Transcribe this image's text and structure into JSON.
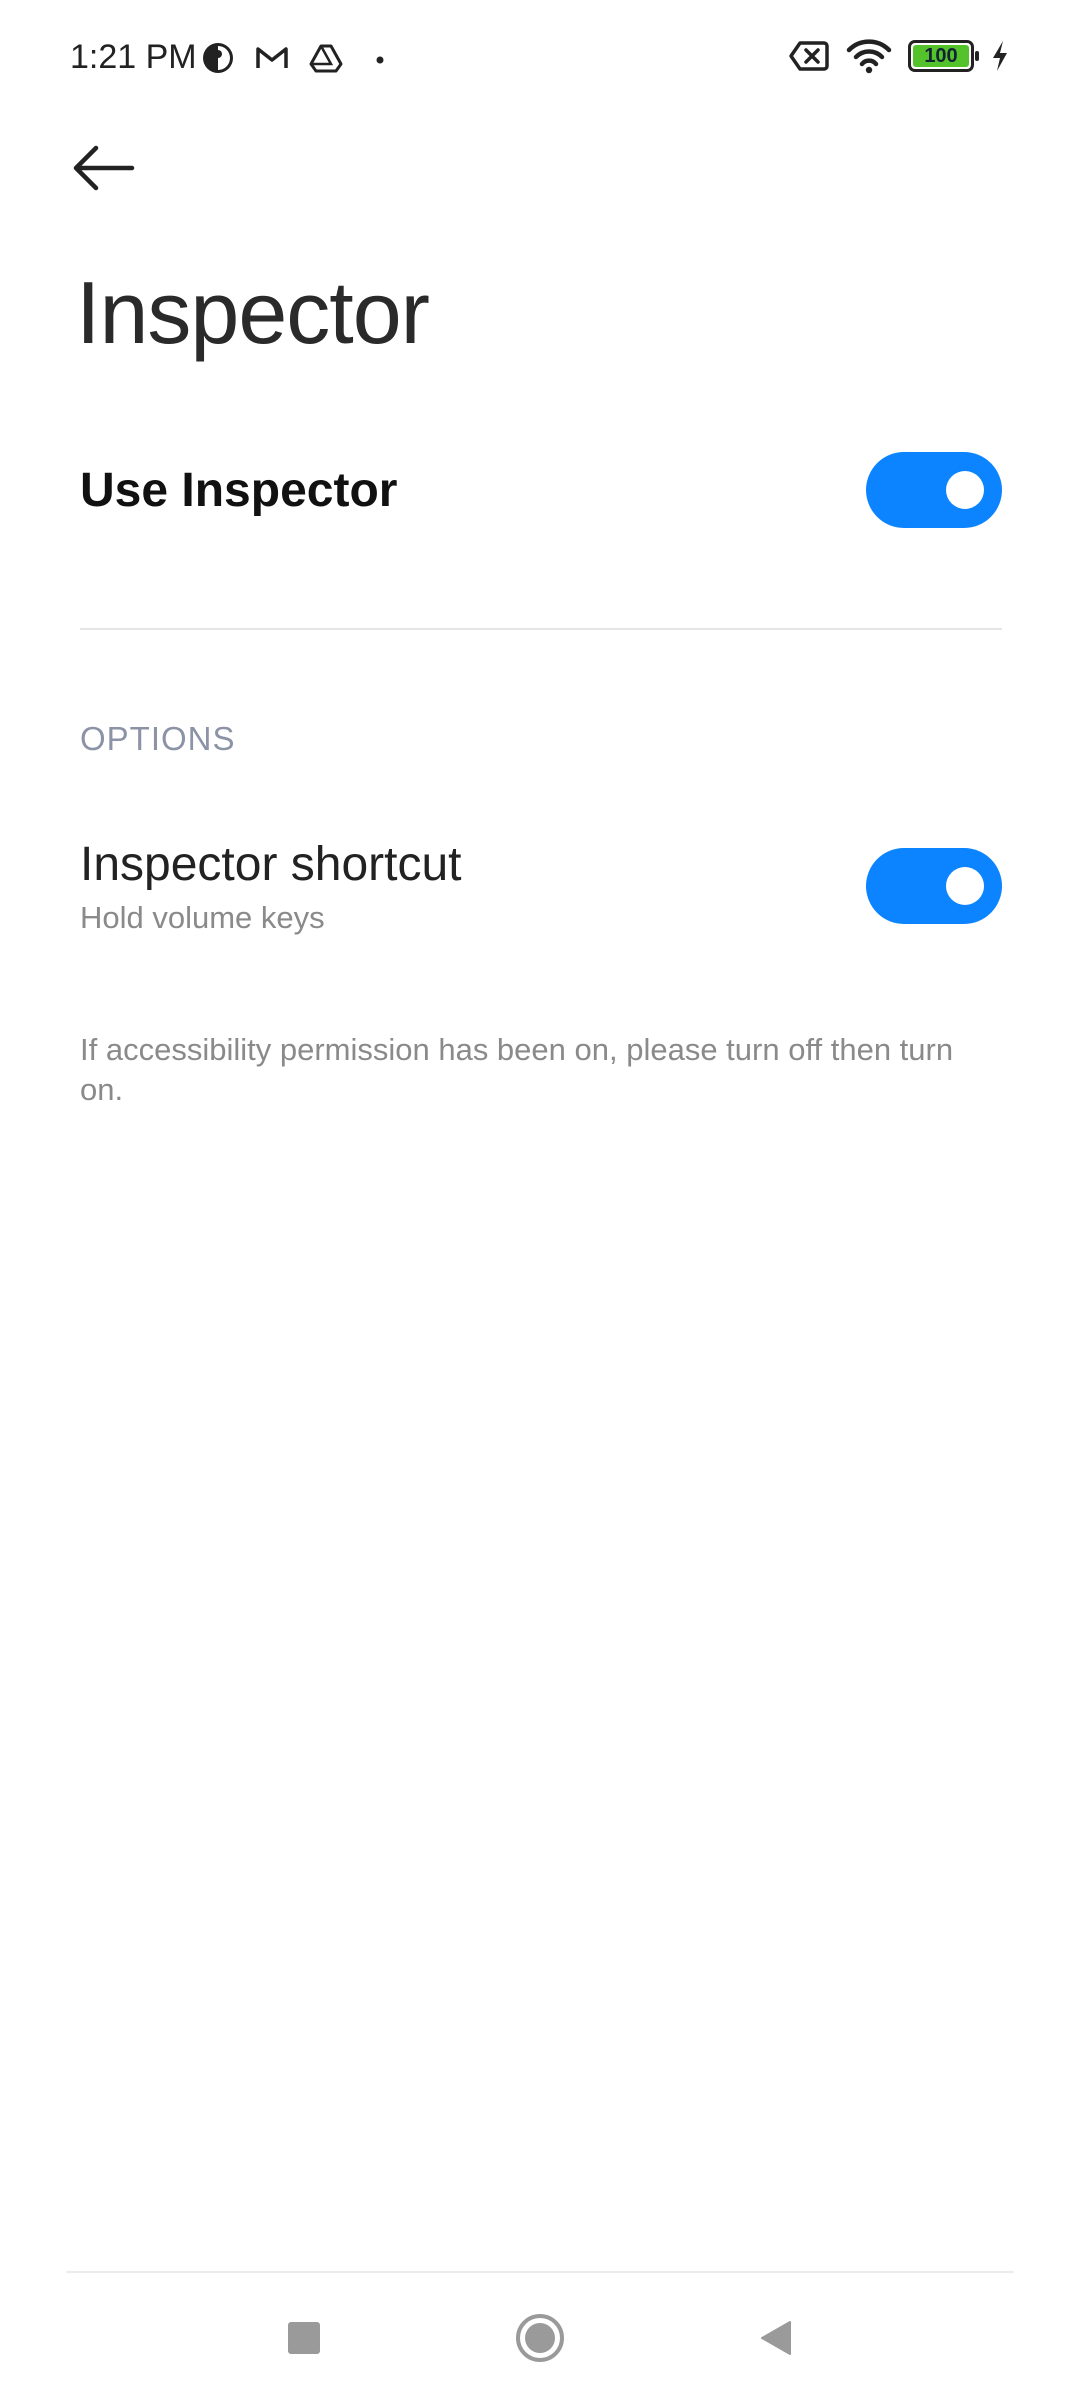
{
  "status_bar": {
    "time": "1:21 PM",
    "battery_level": "100",
    "battery_fraction": 1.0,
    "left_icons": [
      "app-notification-icon",
      "gmail-icon",
      "drive-icon",
      "dot-icon"
    ],
    "right_icons": [
      "no-sim-icon",
      "wifi-icon",
      "battery-icon",
      "charging-icon"
    ]
  },
  "page": {
    "title": "Inspector"
  },
  "use_inspector": {
    "label": "Use Inspector",
    "enabled": true
  },
  "options": {
    "header": "OPTIONS",
    "shortcut": {
      "label": "Inspector shortcut",
      "subtitle": "Hold volume keys",
      "enabled": true
    }
  },
  "note": "If accessibility permission has been on, please turn off then turn on.",
  "colors": {
    "accent": "#0d84ff",
    "battery_fill": "#54c22b",
    "section_header": "#8c93a6",
    "secondary_text": "#8a8a8a"
  },
  "nav_bar": {
    "buttons": [
      "recents-icon",
      "home-icon",
      "back-icon"
    ]
  }
}
